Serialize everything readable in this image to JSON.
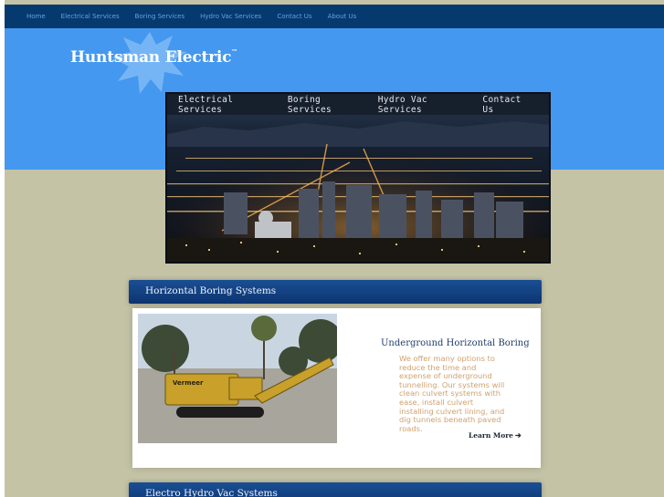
{
  "topnav": {
    "items": [
      "Home",
      "Electrical Services",
      "Boring Services",
      "Hydro Vac Services",
      "Contact Us",
      "About Us"
    ]
  },
  "brand": {
    "name": "Huntsman Electric",
    "trademark": "™"
  },
  "photo_nav": {
    "items": [
      "Electrical Services",
      "Boring Services",
      "Hydro Vac Services",
      "Contact Us"
    ]
  },
  "section1": {
    "title": "Horizontal Boring Systems",
    "heading": "Underground Horizontal Boring",
    "body": "We offer many options to reduce the time and expense of underground tunnelling. Our systems will clean culvert systems with ease, install culvert installing culvert lining, and dig tunnels beneath paved roads.",
    "learn_more": "Learn More",
    "learn_more_icon": "arrow-right-icon"
  },
  "section2": {
    "title": "Electro Hydro Vac Systems"
  },
  "colors": {
    "nav_bg": "#063a6e",
    "nav_text": "#5fa3e6",
    "hero_bg": "#4498ef",
    "page_bg": "#c4c3a6",
    "section_bar": "#0d3570",
    "body_text": "#cfa26f"
  }
}
